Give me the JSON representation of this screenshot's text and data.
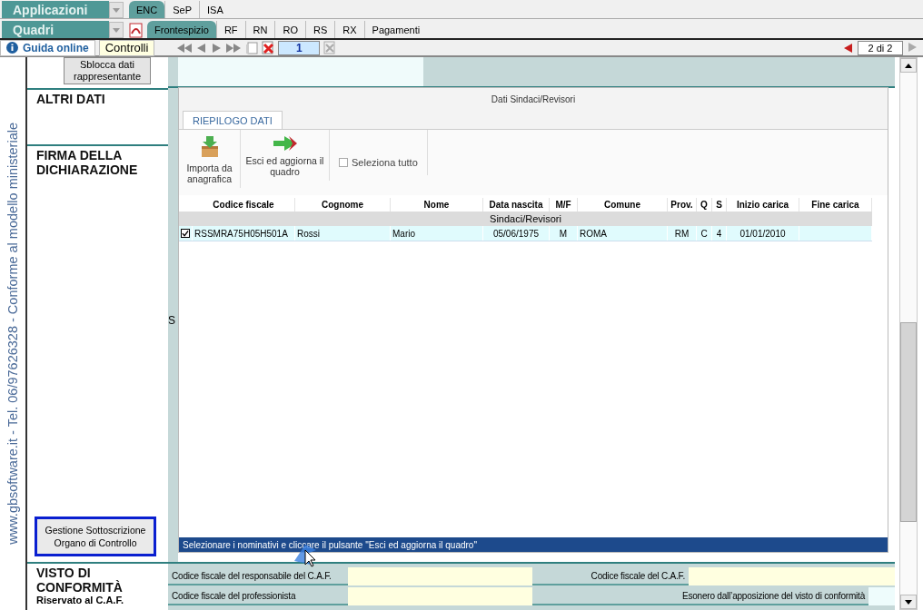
{
  "menus": [
    {
      "label": "Applicazioni"
    },
    {
      "label": "Quadri"
    }
  ],
  "module_tabs": [
    {
      "label": "ENC",
      "selected": true
    },
    {
      "label": "SeP",
      "selected": false
    },
    {
      "label": "ISA",
      "selected": false
    }
  ],
  "section_tabs": [
    {
      "label": "Frontespizio",
      "selected": true
    },
    {
      "label": "RF",
      "selected": false
    },
    {
      "label": "RN",
      "selected": false
    },
    {
      "label": "RO",
      "selected": false
    },
    {
      "label": "RS",
      "selected": false
    },
    {
      "label": "RX",
      "selected": false
    },
    {
      "label": "Pagamenti",
      "selected": false
    }
  ],
  "toolbar": {
    "help": "Guida online",
    "checks": "Controlli",
    "page": "1",
    "pager": "2 di 2"
  },
  "side_caption": "www.gbsoftware.it - Tel. 06/97626328 - Conforme al modello ministeriale",
  "form": {
    "unlock_button": "Sblocca dati rappresentante",
    "sections": [
      {
        "title": "ALTRI DATI"
      },
      {
        "title": "FIRMA DELLA DICHIARAZIONE"
      }
    ],
    "fragment": "S",
    "control_button": {
      "label": "Gestione Sottoscrizione Organo di Controllo",
      "highlighted": true
    },
    "visto": {
      "title": "VISTO DI CONFORMITÀ",
      "subtitle": "Riservato al C.A.F.",
      "rows": [
        {
          "left_label": "Codice fiscale del responsabile del C.A.F.",
          "right_label": "Codice fiscale del C.A.F."
        },
        {
          "left_label": "Codice fiscale del professionista",
          "right_label": "Esonero dall’apposizione del visto di conformità"
        }
      ]
    }
  },
  "dialog": {
    "title": "Dati Sindaci/Revisori",
    "tab": "RIEPILOGO DATI",
    "actions": [
      {
        "label": "Importa da anagrafica",
        "kind": "import"
      },
      {
        "label": "Esci ed aggiorna il quadro",
        "kind": "exit"
      }
    ],
    "select_all": {
      "label": "Seleziona tutto",
      "checked": false
    },
    "columns": [
      "Codice fiscale",
      "Cognome",
      "Nome",
      "Data nascita",
      "M/F",
      "Comune",
      "Prov.",
      "Q",
      "S",
      "Inizio carica",
      "Fine carica"
    ],
    "group": "Sindaci/Revisori",
    "rows": [
      {
        "checked": true,
        "cells": [
          "RSSMRA75H05H501A",
          "Rossi",
          "Mario",
          "05/06/1975",
          "M",
          "ROMA",
          "RM",
          "C",
          "4",
          "01/01/2010",
          null
        ]
      }
    ],
    "status": "Selezionare i nominativi e cliccare il pulsante \"Esci ed aggiorna il quadro\""
  }
}
